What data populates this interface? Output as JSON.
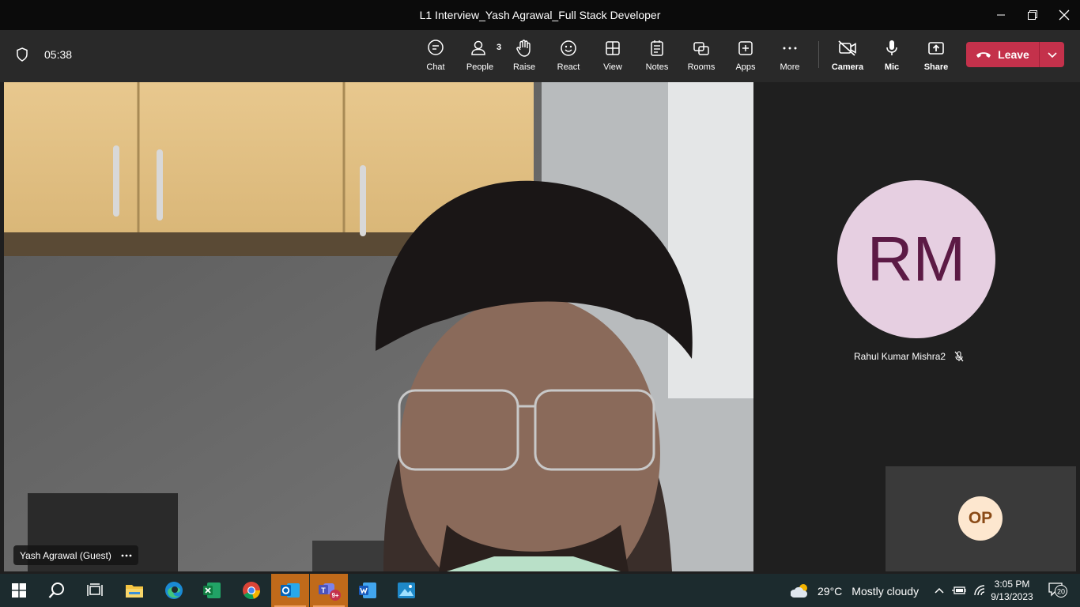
{
  "window": {
    "title": "L1 Interview_Yash Agrawal_Full Stack Developer"
  },
  "meeting": {
    "timer": "05:38",
    "toolbar": [
      {
        "id": "chat",
        "label": "Chat",
        "icon": "chat-icon"
      },
      {
        "id": "people",
        "label": "People",
        "icon": "people-icon",
        "count": "3"
      },
      {
        "id": "raise",
        "label": "Raise",
        "icon": "hand-icon"
      },
      {
        "id": "react",
        "label": "React",
        "icon": "smiley-icon"
      },
      {
        "id": "view",
        "label": "View",
        "icon": "grid-icon"
      },
      {
        "id": "notes",
        "label": "Notes",
        "icon": "notes-icon"
      },
      {
        "id": "rooms",
        "label": "Rooms",
        "icon": "rooms-icon"
      },
      {
        "id": "apps",
        "label": "Apps",
        "icon": "plus-icon"
      },
      {
        "id": "more",
        "label": "More",
        "icon": "ellipsis-icon"
      }
    ],
    "media": {
      "camera_label": "Camera",
      "mic_label": "Mic",
      "share_label": "Share"
    },
    "leave_label": "Leave"
  },
  "participants": {
    "main": {
      "name": "Yash Agrawal (Guest)"
    },
    "rm": {
      "initials": "RM",
      "name": "Rahul Kumar Mishra2",
      "muted": true,
      "color": "#e6cfe1"
    },
    "op": {
      "initials": "OP",
      "color": "#fde7cf"
    }
  },
  "taskbar": {
    "apps": [
      "windows-start",
      "search",
      "task-view",
      "file-explorer",
      "edge",
      "excel",
      "chrome",
      "outlook",
      "teams",
      "word",
      "photos"
    ],
    "teams_badge": "9+",
    "weather": {
      "temp": "29°C",
      "condition": "Mostly cloudy"
    },
    "clock": {
      "time": "3:05 PM",
      "date": "9/13/2023"
    },
    "notifications": "20"
  },
  "colors": {
    "leave": "#c4314b",
    "toolbar": "#292929",
    "accent_active": "#c06a1a"
  }
}
